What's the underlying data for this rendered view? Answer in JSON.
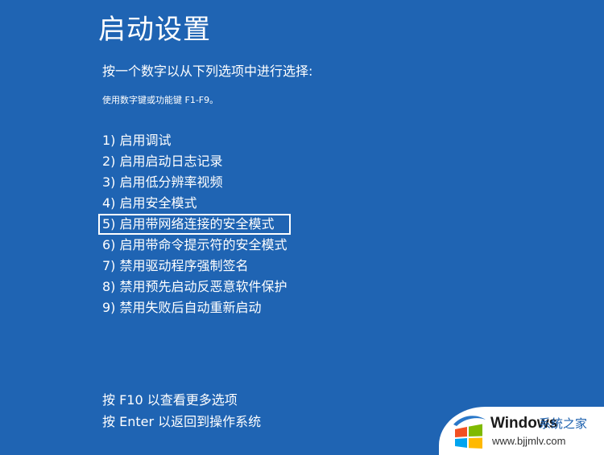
{
  "screen": {
    "title": "启动设置",
    "instruction": "按一个数字以从下列选项中进行选择:",
    "subinstruction": "使用数字键或功能键 F1-F9。",
    "options": [
      {
        "label": "1) 启用调试"
      },
      {
        "label": "2) 启用启动日志记录"
      },
      {
        "label": "3) 启用低分辨率视频"
      },
      {
        "label": "4) 启用安全模式"
      },
      {
        "label": "5) 启用带网络连接的安全模式",
        "selected": true
      },
      {
        "label": "6) 启用带命令提示符的安全模式"
      },
      {
        "label": "7) 禁用驱动程序强制签名"
      },
      {
        "label": "8) 禁用预先启动反恶意软件保护"
      },
      {
        "label": "9) 禁用失败后自动重新启动"
      }
    ],
    "footer": {
      "more_options": "按 F10 以查看更多选项",
      "return": "按 Enter 以返回到操作系统"
    }
  },
  "watermark": {
    "brand": "Windows",
    "site_name": "系统之家",
    "url": "www.bjjmlv.com",
    "logo_icon": "windows-logo-icon"
  },
  "colors": {
    "background": "#1f64b3",
    "text": "#ffffff",
    "watermark_bg": "#ffffff",
    "watermark_site": "#1b5fad"
  }
}
